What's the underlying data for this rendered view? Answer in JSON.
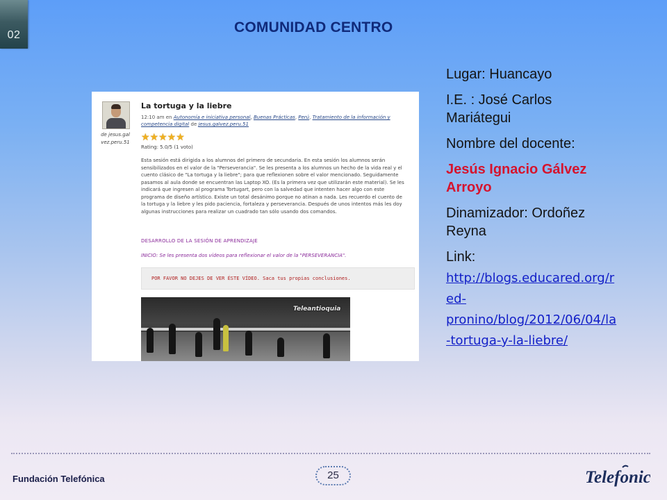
{
  "slide": {
    "number": "02",
    "title": "COMUNIDAD CENTRO"
  },
  "blog": {
    "post_title": "La tortuga y la liebre",
    "meta_time": "12:10 am en",
    "meta_links": [
      "Autonomía e iniciativa personal",
      "Buenas Prácticas",
      "Perú",
      "Tratamiento de la información y competencia digital"
    ],
    "meta_by": "de",
    "meta_author": "jesus.galvez.peru.51",
    "author_caption": "de jesus.galvez.peru.51",
    "stars": "★★★★★",
    "rating": "Rating: 5.0/5 (1 voto)",
    "body": "Esta sesión está dirigida a los alumnos del primero de secundaria. En esta sesión los alumnos serán sensibilizados en el valor de la \"Perseverancia\". Se les presenta a los alumnos un hecho de la vida real y el cuento clásico de \"La tortuga y la liebre\"; para que reflexionen sobre el valor mencionado. Seguidamente pasamos al aula donde se encuentran las Laptop XO. (Es la primera vez que utilizarán este material). Se les indicará que ingresen al programa Tortugart, pero con la salvedad que intenten hacer algo con este programa de diseño artístico. Existe un total desánimo porque no atinan a nada. Les recuerdo el cuento de la tortuga y la liebre y les pido paciencia, fortaleza y perseverancia. Después de unos intentos más les doy algunas instrucciones para realizar un cuadrado tan sólo usando dos comandos.",
    "section_heading": "DESARROLLO DE LA SESIÓN DE APRENDIZAJE",
    "inicio": "INICIO: Se les presenta dos vídeos para reflexionar el valor de la \"PERSEVERANCIA\".",
    "warning": "POR FAVOR NO DEJES DE VER ÉSTE VÍDEO. Saca tus propias conclusiones.",
    "video_logo": "Teleantioquia"
  },
  "info": {
    "lugar": "Lugar: Huancayo",
    "ie": "I.E. : José Carlos Mariátegui",
    "docente_label": "Nombre del docente:",
    "docente": "Jesús Ignacio Gálvez Arroyo",
    "dinamizador": "Dinamizador: Ordoñez Reyna",
    "link_label": "Link:",
    "link": "http://blogs.educared.org/red-pronino/blog/2012/06/04/la-tortuga-y-la-liebre/"
  },
  "footer": {
    "org": "Fundación Telefónica",
    "page": "25",
    "brand": "Telefonica"
  },
  "colors": {
    "title": "#102a7a",
    "teacher": "#d5142e",
    "link": "#1320c8",
    "footer_text": "#1b1f4a"
  }
}
